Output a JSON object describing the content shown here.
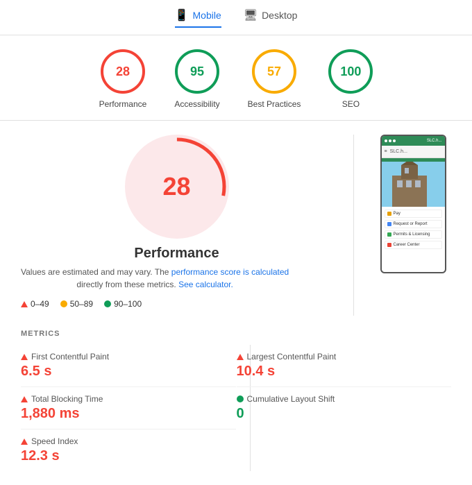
{
  "tabs": [
    {
      "id": "mobile",
      "label": "Mobile",
      "active": true,
      "icon": "📱"
    },
    {
      "id": "desktop",
      "label": "Desktop",
      "active": false,
      "icon": "🖥"
    }
  ],
  "scores": [
    {
      "id": "performance",
      "value": "28",
      "label": "Performance",
      "color": "#f44336",
      "bg": "#fce8ea"
    },
    {
      "id": "accessibility",
      "value": "95",
      "label": "Accessibility",
      "color": "#0f9d58",
      "bg": "#e6f4ea"
    },
    {
      "id": "best-practices",
      "value": "57",
      "label": "Best Practices",
      "color": "#f9ab00",
      "bg": "#fef7e0"
    },
    {
      "id": "seo",
      "value": "100",
      "label": "SEO",
      "color": "#0f9d58",
      "bg": "#e6f4ea"
    }
  ],
  "main": {
    "big_score": "28",
    "title": "Performance",
    "desc_start": "Values are estimated and may vary. The",
    "desc_link1": "performance score is calculated",
    "desc_mid": "directly from these metrics.",
    "desc_link2": "See calculator.",
    "legend": [
      {
        "range": "0–49",
        "color_type": "triangle",
        "color": "#f44336"
      },
      {
        "range": "50–89",
        "color_type": "circle",
        "color": "#f9ab00"
      },
      {
        "range": "90–100",
        "color_type": "circle",
        "color": "#0f9d58"
      }
    ]
  },
  "phone": {
    "url": "SLC.h...",
    "menu_items": [
      {
        "icon": "$",
        "label": "Pay"
      },
      {
        "icon": "R",
        "label": "Request or Report"
      },
      {
        "icon": "P",
        "label": "Permits & Licensing"
      },
      {
        "icon": "C",
        "label": "Career Center"
      }
    ]
  },
  "metrics": {
    "header": "METRICS",
    "left": [
      {
        "id": "fcp",
        "label": "First Contentful Paint",
        "value": "6.5 s",
        "status": "red"
      },
      {
        "id": "tbt",
        "label": "Total Blocking Time",
        "value": "1,880 ms",
        "status": "red"
      },
      {
        "id": "si",
        "label": "Speed Index",
        "value": "12.3 s",
        "status": "red"
      }
    ],
    "right": [
      {
        "id": "lcp",
        "label": "Largest Contentful Paint",
        "value": "10.4 s",
        "status": "red"
      },
      {
        "id": "cls",
        "label": "Cumulative Layout Shift",
        "value": "0",
        "status": "green"
      }
    ]
  }
}
